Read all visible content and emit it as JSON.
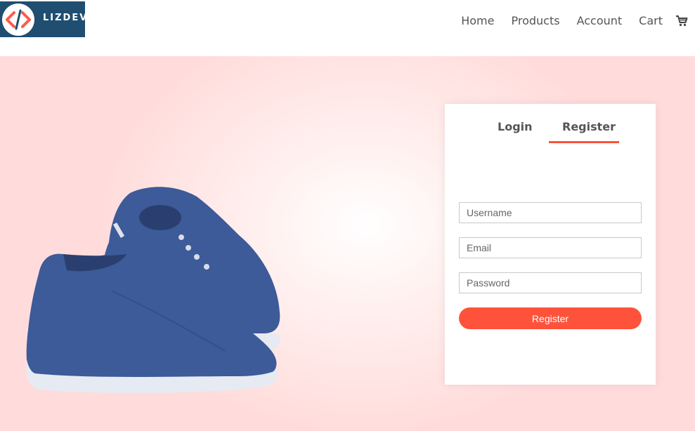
{
  "brand": {
    "name": "LIZDEV"
  },
  "nav": {
    "items": [
      {
        "label": "Home"
      },
      {
        "label": "Products"
      },
      {
        "label": "Account"
      },
      {
        "label": "Cart"
      }
    ],
    "cart_icon": "shopping-cart-icon"
  },
  "form": {
    "tabs": [
      {
        "label": "Login"
      },
      {
        "label": "Register"
      }
    ],
    "active_tab": "Register",
    "username_placeholder": "Username",
    "email_placeholder": "Email",
    "password_placeholder": "Password",
    "submit_label": "Register"
  },
  "colors": {
    "accent": "#ff523b",
    "brand_bg": "#1f4e70",
    "hero_bg": "#ffdcdb",
    "shoe": "#3d5a99"
  }
}
